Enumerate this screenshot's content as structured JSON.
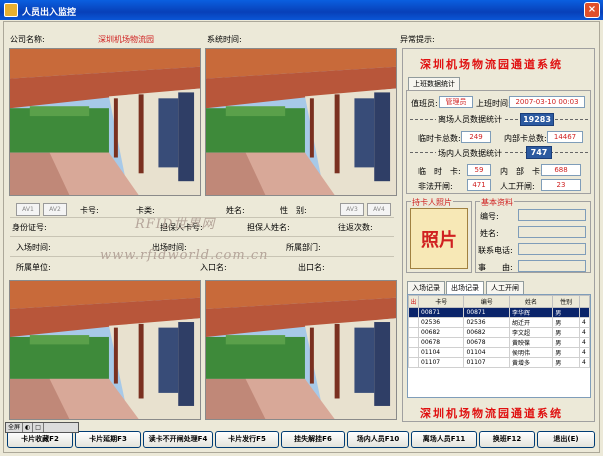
{
  "window": {
    "title": "人员出入监控",
    "close": "×"
  },
  "header": {
    "company_label": "公司名称:",
    "company_name": "深圳机场物流园",
    "time_label": "系统时间:",
    "notice_label": "异常提示:"
  },
  "info": {
    "av1": "AV1",
    "av2": "AV2",
    "av3": "AV3",
    "av4": "AV4",
    "card_no": "卡号:",
    "card_type": "卡类:",
    "name": "姓名:",
    "sex": "性　别:",
    "id_card": "身份证号:",
    "sponsor_card": "担保人卡号:",
    "sponsor_name": "担保人姓名:",
    "visits": "往返次数:",
    "entry_date": "入场时间:",
    "exit_time": "出场时间:",
    "department": "所属部门:",
    "unit": "所属单位:",
    "entry_gate": "入口名:",
    "exit_gate": "出口名:"
  },
  "watermark": {
    "line1": "RFID世界网",
    "line2": "www.rfidworld.com.cn"
  },
  "right": {
    "system_title": "深圳机场物流园通道系统",
    "tab_stats": "上班数据统计",
    "duty_label": "值班员:",
    "duty_value": "管理员",
    "shift_time_label": "上班时间:",
    "shift_time_value": "2007-03-10 00:03",
    "leave_stats_label": "离场人员数据统计",
    "leave_stats_value": "19283",
    "temp_total_label": "临时卡总数:",
    "temp_total_value": "249",
    "internal_total_label": "内部卡总数:",
    "internal_total_value": "14467",
    "in_stats_label": "场内人员数据统计",
    "in_stats_value": "747",
    "temp_label": "临　时　卡:",
    "temp_value": "59",
    "internal_label": "内　部　卡:",
    "internal_value": "688",
    "illegal_label": "非法开闸:",
    "illegal_value": "471",
    "manual_label": "人工开闸:",
    "manual_value": "23",
    "photo_group": "持卡人照片",
    "photo_text": "照片",
    "basic_group": "基本资料",
    "f_no": "编号:",
    "f_name": "姓名:",
    "f_phone": "联系电话:",
    "f_reason": "事　　由:",
    "tabs": [
      "入场记录",
      "出场记录",
      "人工开闸"
    ],
    "footer_title": "深圳机场物流园通道系统"
  },
  "grid": {
    "corner": "出",
    "columns": [
      "卡号",
      "编号",
      "姓名",
      "性别",
      ""
    ],
    "rows": [
      [
        "00871",
        "00871",
        "李华辉",
        "男",
        ""
      ],
      [
        "02536",
        "02536",
        "胡迁开",
        "男",
        "4"
      ],
      [
        "00682",
        "00682",
        "李文超",
        "男",
        "4"
      ],
      [
        "00678",
        "00678",
        "黄映葆",
        "男",
        "4"
      ],
      [
        "01104",
        "01104",
        "侯明伟",
        "男",
        "4"
      ],
      [
        "01107",
        "01107",
        "黄增多",
        "男",
        "4"
      ]
    ]
  },
  "toolbar": {
    "fullscreen": "全屏",
    "t2": "◐",
    "t3": "□"
  },
  "buttons": [
    "卡片收藏F2",
    "卡片延期F3",
    "读卡不开闸处理F4",
    "卡片发行F5",
    "挂失解挂F6",
    "场内人员F10",
    "离场人员F11",
    "换班F12",
    "退出(E)"
  ]
}
